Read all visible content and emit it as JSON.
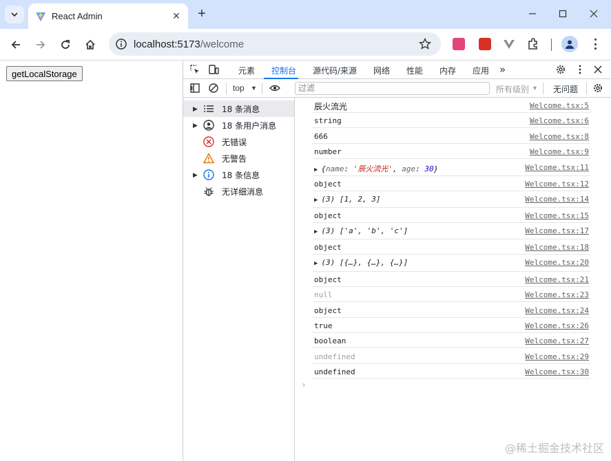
{
  "browser": {
    "tab_title": "React Admin",
    "new_tab": "+",
    "url_host": "localhost:5173",
    "url_path": "/welcome"
  },
  "page": {
    "button_label": "getLocalStorage"
  },
  "devtools": {
    "tabs": [
      "元素",
      "控制台",
      "源代码/来源",
      "网络",
      "性能",
      "内存",
      "应用"
    ],
    "more_tabs": "»",
    "context": "top",
    "filter_placeholder": "过滤",
    "levels": "所有级别",
    "issues": "无问题"
  },
  "sidebar": {
    "items": [
      {
        "label": "18 条消息",
        "icon": "list-icon",
        "expandable": true
      },
      {
        "label": "18 条用户消息",
        "icon": "user-icon",
        "expandable": true
      },
      {
        "label": "无错误",
        "icon": "error-icon",
        "expandable": false
      },
      {
        "label": "无警告",
        "icon": "warning-icon",
        "expandable": false
      },
      {
        "label": "18 条信息",
        "icon": "info-icon",
        "expandable": true
      },
      {
        "label": "无详细消息",
        "icon": "bug-icon",
        "expandable": false
      }
    ]
  },
  "console": {
    "messages": [
      {
        "text": "辰火流光",
        "source": "Welcome.tsx:5"
      },
      {
        "text": "string",
        "source": "Welcome.tsx:6"
      },
      {
        "text": "666",
        "source": "Welcome.tsx:8"
      },
      {
        "text": "number",
        "source": "Welcome.tsx:9"
      },
      {
        "text": "{name: '辰火流光', age: 30}",
        "source": "Welcome.tsx:11"
      },
      {
        "text": "object",
        "source": "Welcome.tsx:12"
      },
      {
        "text": "(3) [1, 2, 3]",
        "source": "Welcome.tsx:14"
      },
      {
        "text": "object",
        "source": "Welcome.tsx:15"
      },
      {
        "text": "(3) ['a', 'b', 'c']",
        "source": "Welcome.tsx:17"
      },
      {
        "text": "object",
        "source": "Welcome.tsx:18"
      },
      {
        "text": "(3) [{…}, {…}, {…}]",
        "source": "Welcome.tsx:20"
      },
      {
        "text": "object",
        "source": "Welcome.tsx:21"
      },
      {
        "text": "null",
        "source": "Welcome.tsx:23"
      },
      {
        "text": "object",
        "source": "Welcome.tsx:24"
      },
      {
        "text": "true",
        "source": "Welcome.tsx:26"
      },
      {
        "text": "boolean",
        "source": "Welcome.tsx:27"
      },
      {
        "text": "undefined",
        "source": "Welcome.tsx:29"
      },
      {
        "text": "undefined",
        "source": "Welcome.tsx:30"
      }
    ],
    "prompt": "›"
  },
  "obj_parts": {
    "name_key": "name",
    "name_val": "'辰火流光'",
    "age_key": "age",
    "age_val": "30"
  },
  "watermark": "@稀土掘金技术社区",
  "colors": {
    "titlebar": "#d3e3fd",
    "active_tab": "#1a73e8",
    "link": "#5f6368"
  }
}
